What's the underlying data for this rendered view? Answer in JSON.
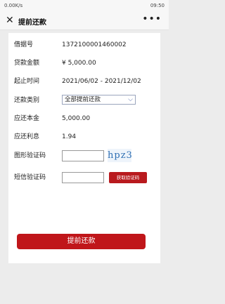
{
  "status": {
    "left": "0.00K/s",
    "right": "09:50"
  },
  "header": {
    "close_glyph": "✕",
    "title": "提前还款",
    "more_glyph": "•••"
  },
  "form": {
    "loan_no": {
      "label": "借据号",
      "value": "1372100001460002"
    },
    "loan_amount": {
      "label": "贷款金额",
      "value": "¥ 5,000.00"
    },
    "period": {
      "label": "起止时间",
      "value": "2021/06/02 - 2021/12/02"
    },
    "repay_type": {
      "label": "还款类别",
      "value": "全部提前还款"
    },
    "principal": {
      "label": "应还本金",
      "value": "5,000.00"
    },
    "interest": {
      "label": "应还利息",
      "value": "1.94"
    },
    "captcha": {
      "label": "图形验证码",
      "image_text": "hpz3",
      "value": ""
    },
    "sms_code": {
      "label": "短信验证码",
      "button": "获取验证码",
      "value": ""
    }
  },
  "submit_label": "提前还款",
  "icons": {
    "arrow": "chevron-down-icon"
  },
  "colors": {
    "accent": "#c0161a",
    "select_border": "#9aa5bd"
  }
}
